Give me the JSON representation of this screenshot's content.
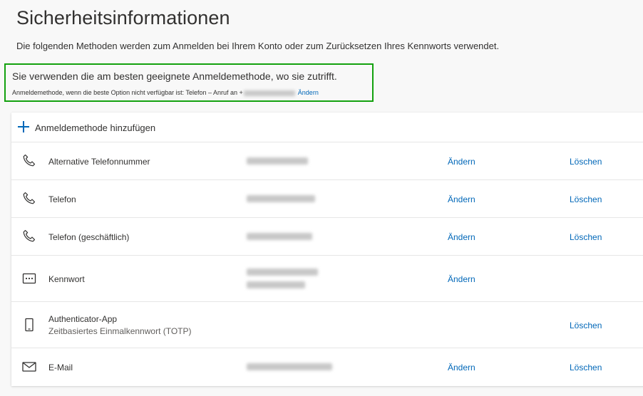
{
  "page": {
    "title": "Sicherheitsinformationen",
    "subtitle": "Die folgenden Methoden werden zum Anmelden bei Ihrem Konto oder zum Zurücksetzen Ihres Kennworts verwendet."
  },
  "default_method": {
    "headline": "Sie verwenden die am besten geeignete Anmeldemethode, wo sie zutrifft.",
    "detail_prefix": "Anmeldemethode, wenn die beste Option nicht verfügbar ist: Telefon – Anruf an +",
    "change_label": "Ändern"
  },
  "add_method": {
    "label": "Anmeldemethode hinzufügen",
    "icon": "plus-icon",
    "accent": "#0067b8"
  },
  "methods": [
    {
      "icon": "phone-icon",
      "name": "Alternative Telefonnummer",
      "change": "Ändern",
      "delete": "Löschen"
    },
    {
      "icon": "phone-icon",
      "name": "Telefon",
      "change": "Ändern",
      "delete": "Löschen"
    },
    {
      "icon": "phone-icon",
      "name": "Telefon (geschäftlich)",
      "change": "Ändern",
      "delete": "Löschen"
    },
    {
      "icon": "password-icon",
      "name": "Kennwort",
      "change": "Ändern"
    },
    {
      "icon": "authenticator-app-icon",
      "name": "Authenticator-App",
      "subtitle": "Zeitbasiertes Einmalkennwort (TOTP)",
      "delete": "Löschen"
    },
    {
      "icon": "mail-icon",
      "name": "E-Mail",
      "change": "Ändern",
      "delete": "Löschen"
    }
  ],
  "colors": {
    "link": "#0067b8",
    "success_border": "#13a10e",
    "background": "#f8f8f8"
  }
}
